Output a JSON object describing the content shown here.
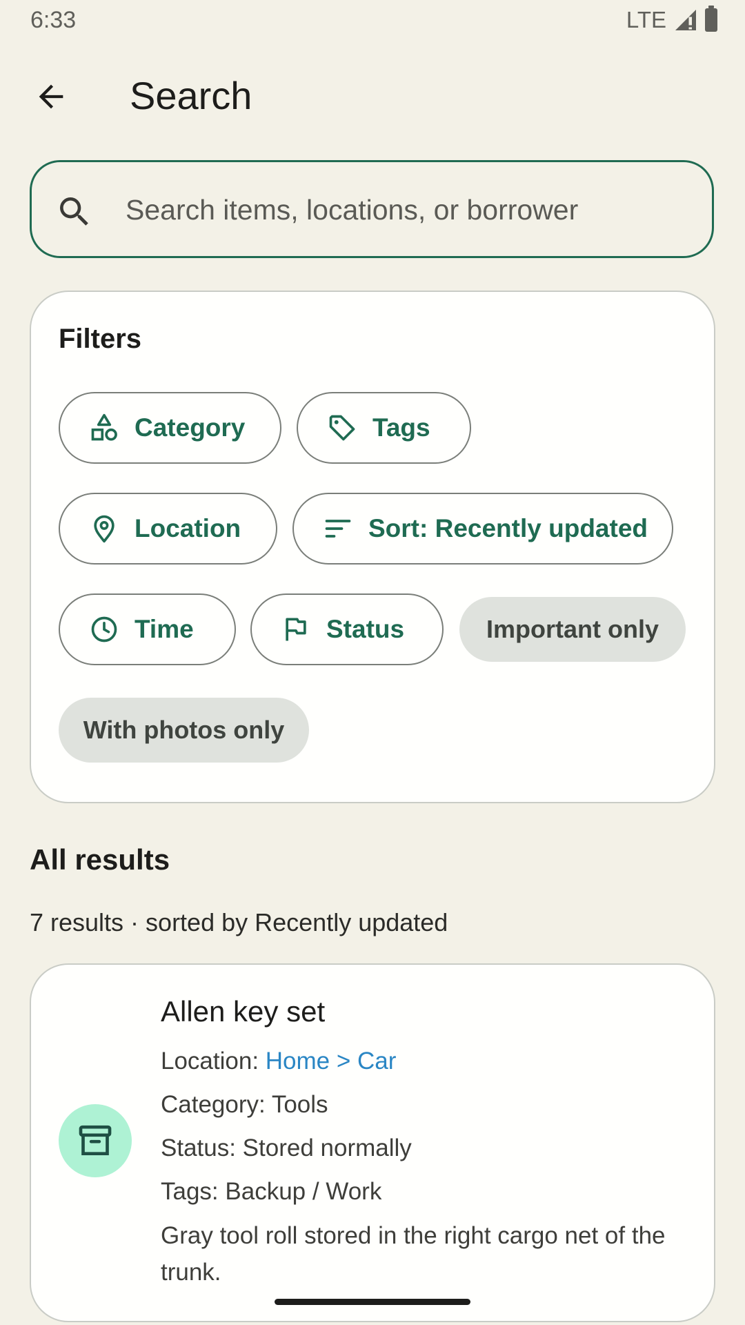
{
  "status_bar": {
    "time": "6:33",
    "network": "LTE"
  },
  "header": {
    "title": "Search"
  },
  "search": {
    "placeholder": "Search items, locations, or borrower",
    "value": ""
  },
  "filters": {
    "title": "Filters",
    "chips": {
      "category": "Category",
      "tags": "Tags",
      "location": "Location",
      "sort": "Sort: Recently updated",
      "time": "Time",
      "status": "Status",
      "important": "Important only",
      "photos": "With photos only"
    }
  },
  "results": {
    "title": "All results",
    "meta": "7 results · sorted by Recently updated",
    "items": [
      {
        "name": "Allen key set",
        "location_label": "Location: ",
        "location": "Home > Car",
        "category": "Category: Tools",
        "status": "Status: Stored normally",
        "tags": "Tags: Backup / Work",
        "description": "Gray tool roll stored in the right cargo net of the trunk.",
        "icon": "archive-box-icon"
      }
    ]
  },
  "colors": {
    "accent": "#1f6b52",
    "link": "#2a86c4",
    "background": "#f3f1e7",
    "avatar_bg": "#aef2d4"
  }
}
